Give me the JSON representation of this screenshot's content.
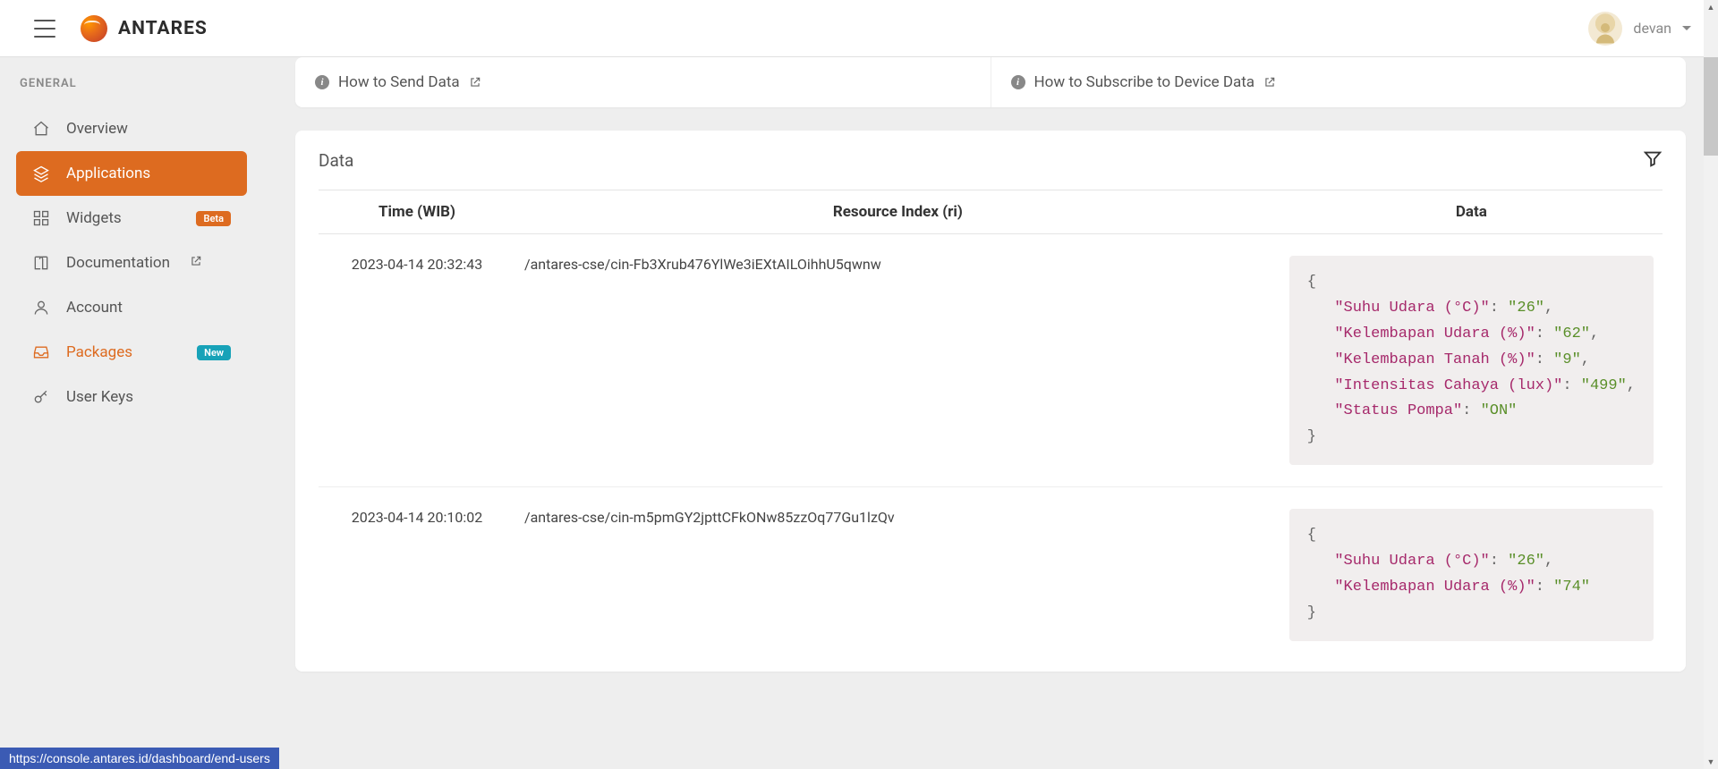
{
  "brand": {
    "name": "ANTARES"
  },
  "user": {
    "name": "devan"
  },
  "sidebar": {
    "section": "GENERAL",
    "items": [
      {
        "label": "Overview"
      },
      {
        "label": "Applications"
      },
      {
        "label": "Widgets",
        "badge": "Beta"
      },
      {
        "label": "Documentation"
      },
      {
        "label": "Account"
      },
      {
        "label": "Packages",
        "badge": "New"
      },
      {
        "label": "User Keys"
      }
    ]
  },
  "help": {
    "send": "How to Send Data",
    "subscribe": "How to Subscribe to Device Data"
  },
  "data_panel": {
    "title": "Data",
    "columns": {
      "time": "Time (WIB)",
      "ri": "Resource Index (ri)",
      "data": "Data"
    },
    "rows": [
      {
        "time": "2023-04-14 20:32:43",
        "ri": "/antares-cse/cin-Fb3Xrub476YlWe3iEXtAILOihhU5qwnw",
        "payload": {
          "Suhu Udara (°C)": "26",
          "Kelembapan Udara (%)": "62",
          "Kelembapan Tanah (%)": "9",
          "Intensitas Cahaya (lux)": "499",
          "Status Pompa": "ON"
        }
      },
      {
        "time": "2023-04-14 20:10:02",
        "ri": "/antares-cse/cin-m5pmGY2jpttCFkONw85zzOq77Gu1lzQv",
        "payload": {
          "Suhu Udara (°C)": "26",
          "Kelembapan Udara (%)": "74"
        }
      }
    ]
  },
  "status_url": "https://console.antares.id/dashboard/end-users"
}
